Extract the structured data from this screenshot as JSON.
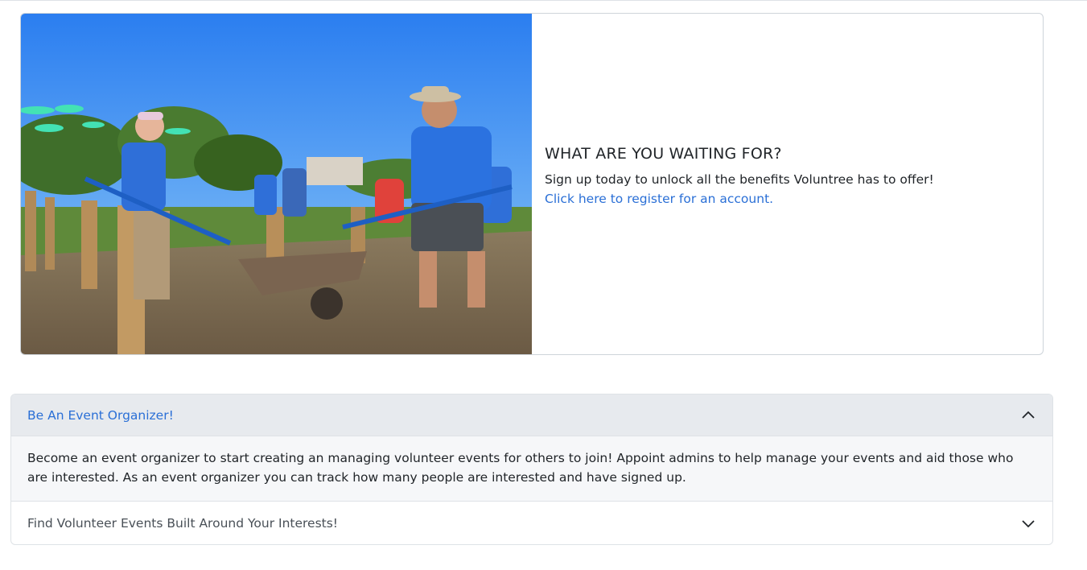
{
  "signup": {
    "title": "WHAT ARE YOU WAITING FOR?",
    "text": "Sign up today to unlock all the benefits Voluntree has to offer!",
    "link": "Click here to register for an account."
  },
  "accordion": {
    "items": [
      {
        "title": "Be An Event Organizer!",
        "expanded": true,
        "body": "Become an event organizer to start creating an managing volunteer events for others to join! Appoint admins to help manage your events and aid those who are interested. As an event organizer you can track how many people are interested and have signed up."
      },
      {
        "title": "Find Volunteer Events Built Around Your Interests!",
        "expanded": false
      }
    ]
  },
  "colors": {
    "link": "#2a6fd6",
    "header_active_bg": "#e7eaee",
    "body_bg": "#f6f7f9"
  },
  "icons": {
    "expanded": "chevron-up-icon",
    "collapsed": "chevron-down-icon"
  }
}
